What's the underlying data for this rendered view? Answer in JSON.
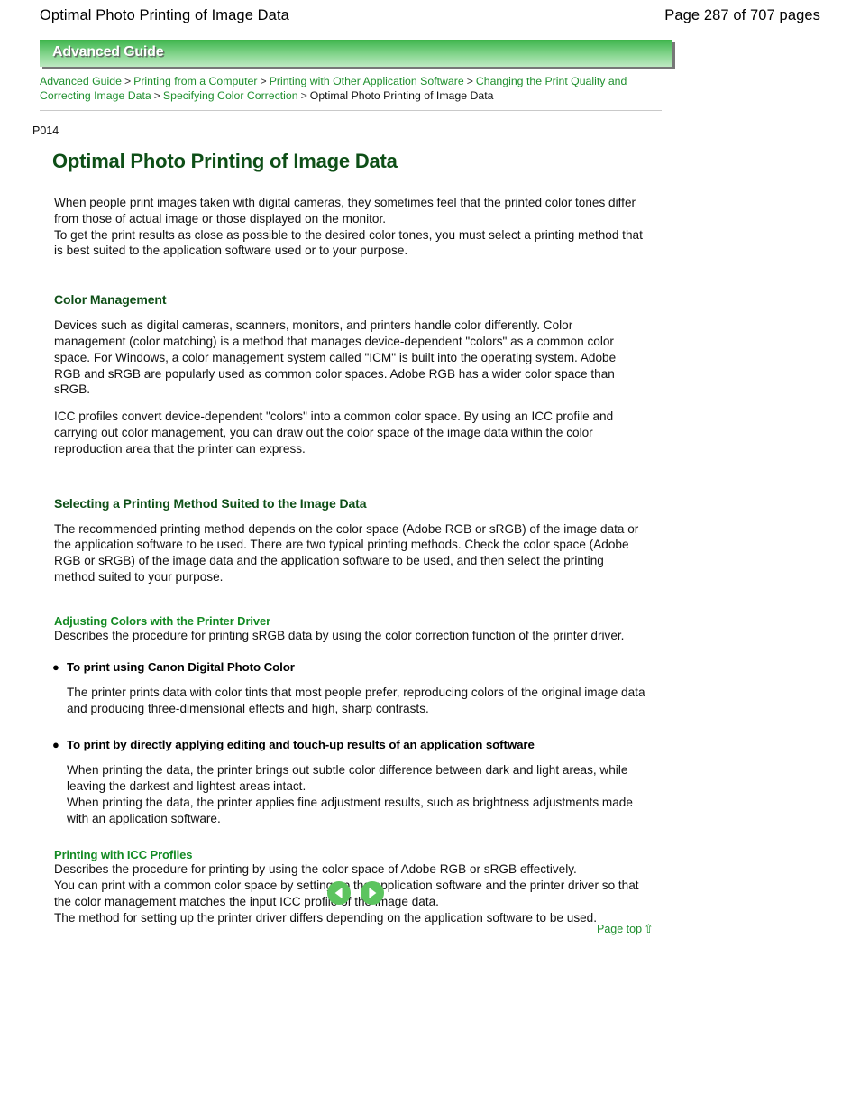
{
  "header": {
    "title": "Optimal Photo Printing of Image Data",
    "page_label": "Page 287 of 707 pages"
  },
  "banner": {
    "label": "Advanced Guide",
    "gradient_top": "#3db44a",
    "gradient_bottom": "#bfe9c3"
  },
  "breadcrumb": {
    "items": [
      {
        "label": "Advanced Guide",
        "current": false
      },
      {
        "label": "Printing from a Computer",
        "current": false
      },
      {
        "label": "Printing with Other Application Software",
        "current": false
      },
      {
        "label": "Changing the Print Quality and Correcting Image Data",
        "current": false
      },
      {
        "label": "Specifying Color Correction",
        "current": false
      },
      {
        "label": "Optimal Photo Printing of Image Data",
        "current": true
      }
    ],
    "separator": ">",
    "link_color": "#1f8f2e"
  },
  "doc": {
    "id": "P014",
    "title": "Optimal Photo Printing of Image Data",
    "title_color": "#0e4f17",
    "intro": {
      "line1": "When people print images taken with digital cameras, they sometimes feel that the printed color tones differ from those of actual image or those displayed on the monitor.",
      "line2": "To get the print results as close as possible to the desired color tones, you must select a printing method that is best suited to the application software used or to your purpose."
    },
    "sections": [
      {
        "heading": "Color Management",
        "paragraphs": [
          "Devices such as digital cameras, scanners, monitors, and printers handle color differently. Color management (color matching) is a method that manages device-dependent \"colors\" as a common color space. For Windows, a color management system called \"ICM\" is built into the operating system. Adobe RGB and sRGB are popularly used as common color spaces. Adobe RGB has a wider color space than sRGB.",
          "ICC profiles convert device-dependent \"colors\" into a common color space. By using an ICC profile and carrying out color management, you can draw out the color space of the image data within the color reproduction area that the printer can express."
        ]
      },
      {
        "heading": "Selecting a Printing Method Suited to the Image Data",
        "paragraphs": [
          "The recommended printing method depends on the color space (Adobe RGB or sRGB) of the image data or the application software to be used. There are two typical printing methods. Check the color space (Adobe RGB or sRGB) of the image data and the application software to be used, and then select the printing method suited to your purpose."
        ]
      }
    ],
    "subsections": [
      {
        "heading": "Adjusting Colors with the Printer Driver",
        "heading_color": "#138a23",
        "description": "Describes the procedure for printing sRGB data by using the color correction function of the printer driver.",
        "bullets": [
          {
            "marker": "●",
            "label": "To print using Canon Digital Photo Color",
            "body": "The printer prints data with color tints that most people prefer, reproducing colors of the original image data and producing three-dimensional effects and high, sharp contrasts."
          },
          {
            "marker": "●",
            "label": "To print by directly applying editing and touch-up results of an application software",
            "body_line1": "When printing the data, the printer brings out subtle color difference between dark and light areas, while leaving the darkest and lightest areas intact.",
            "body_line2": "When printing the data, the printer applies fine adjustment results, such as brightness adjustments made with an application software."
          }
        ]
      },
      {
        "heading": "Printing with ICC Profiles",
        "heading_color": "#138a23",
        "line1": "Describes the procedure for printing by using the color space of Adobe RGB or sRGB effectively.",
        "line2": "You can print with a common color space by setting up the application software and the printer driver so that the color management matches the input ICC profile of the image data.",
        "line3": "The method for setting up the printer driver differs depending on the application software to be used."
      }
    ]
  },
  "footer": {
    "prev_label": "Previous page",
    "next_label": "Next page",
    "page_top_label": "Page top",
    "page_top_arrow": "⇧",
    "arrow_color": "#5cc45f"
  }
}
